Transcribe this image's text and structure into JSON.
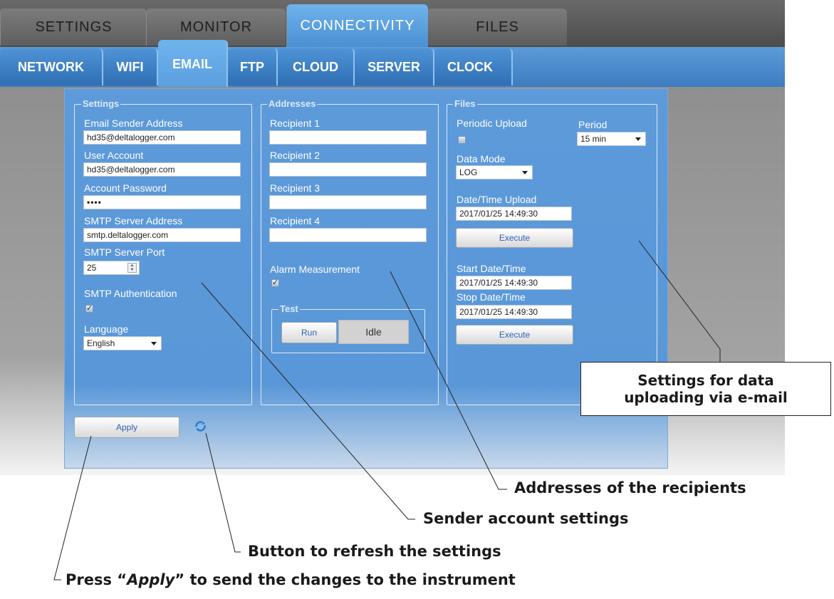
{
  "top_tabs": [
    "SETTINGS",
    "MONITOR",
    "CONNECTIVITY",
    "FILES"
  ],
  "sub_tabs": [
    "NETWORK",
    "WIFI",
    "EMAIL",
    "FTP",
    "CLOUD",
    "SERVER",
    "CLOCK"
  ],
  "settings": {
    "legend": "Settings",
    "sender_label": "Email Sender Address",
    "sender_value": "hd35@deltalogger.com",
    "user_label": "User Account",
    "user_value": "hd35@deltalogger.com",
    "password_label": "Account Password",
    "password_value": "••••",
    "smtp_address_label": "SMTP Server Address",
    "smtp_address_value": "smtp.deltalogger.com",
    "smtp_port_label": "SMTP Server Port",
    "smtp_port_value": "25",
    "auth_label": "SMTP Authentication",
    "language_label": "Language",
    "language_value": "English"
  },
  "addresses": {
    "legend": "Addresses",
    "recipients": [
      "Recipient 1",
      "Recipient 2",
      "Recipient 3",
      "Recipient 4"
    ],
    "alarm_label": "Alarm Measurement"
  },
  "test": {
    "legend": "Test",
    "run_label": "Run",
    "status": "Idle"
  },
  "files": {
    "legend": "Files",
    "periodic_label": "Periodic Upload",
    "period_label": "Period",
    "period_value": "15 min",
    "data_mode_label": "Data Mode",
    "data_mode_value": "LOG",
    "datetime_upload_label": "Date/Time Upload",
    "datetime_upload_value": "2017/01/25 14:49:30",
    "execute_label": "Execute",
    "start_label": "Start Date/Time",
    "start_value": "2017/01/25 14:49:30",
    "stop_label": "Stop Date/Time",
    "stop_value": "2017/01/25 14:49:30",
    "execute2_label": "Execute"
  },
  "apply_label": "Apply",
  "callouts": {
    "upload_line1": "Settings for data",
    "upload_line2": "uploading via e-mail",
    "recipients": "Addresses of the recipients",
    "sender": "Sender account settings",
    "refresh": "Button to refresh the settings",
    "apply_pre": "Press “",
    "apply_word": "Apply",
    "apply_post": "” to send the changes to the instrument"
  }
}
